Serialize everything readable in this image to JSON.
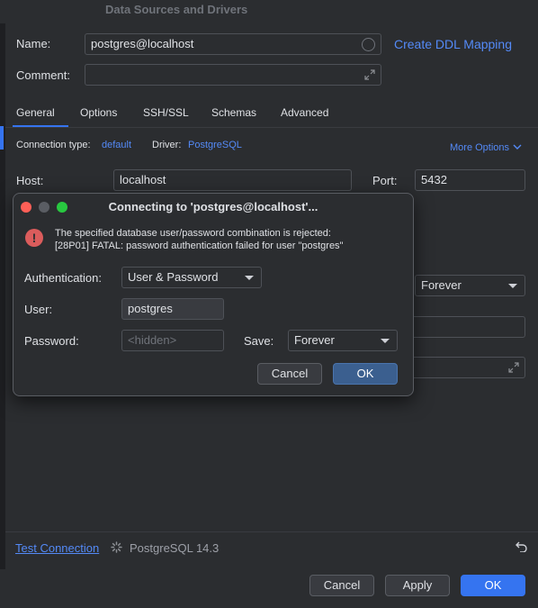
{
  "window": {
    "title": "Data Sources and Drivers"
  },
  "form": {
    "name_label": "Name:",
    "name_value": "postgres@localhost",
    "ddl_link": "Create DDL Mapping",
    "comment_label": "Comment:",
    "comment_value": ""
  },
  "tabs": [
    {
      "label": "General"
    },
    {
      "label": "Options"
    },
    {
      "label": "SSH/SSL"
    },
    {
      "label": "Schemas"
    },
    {
      "label": "Advanced"
    }
  ],
  "connection": {
    "type_label": "Connection type:",
    "type_value": "default",
    "driver_label": "Driver:",
    "driver_value": "PostgreSQL",
    "more_options": "More Options",
    "host_label": "Host:",
    "host_value": "localhost",
    "port_label": "Port:",
    "port_value": "5432",
    "save_value": "Forever"
  },
  "footer": {
    "test_connection": "Test Connection",
    "version": "PostgreSQL 14.3",
    "cancel": "Cancel",
    "apply": "Apply",
    "ok": "OK"
  },
  "modal": {
    "title": "Connecting to 'postgres@localhost'...",
    "error_line1": "The specified database user/password combination is rejected:",
    "error_line2": "[28P01] FATAL: password authentication failed for user \"postgres\"",
    "auth_label": "Authentication:",
    "auth_value": "User & Password",
    "user_label": "User:",
    "user_value": "postgres",
    "password_label": "Password:",
    "password_placeholder": "<hidden>",
    "save_label": "Save:",
    "save_value": "Forever",
    "cancel": "Cancel",
    "ok": "OK"
  },
  "colors": {
    "accent": "#3574f0",
    "link": "#548af7",
    "error": "#db5c5c",
    "close": "#ff5f57",
    "minimize": "#febc2e",
    "zoom": "#28c840"
  },
  "icons": [
    "error-icon",
    "spinner-icon",
    "revert-icon",
    "expand-icon",
    "chevron-down-icon"
  ]
}
